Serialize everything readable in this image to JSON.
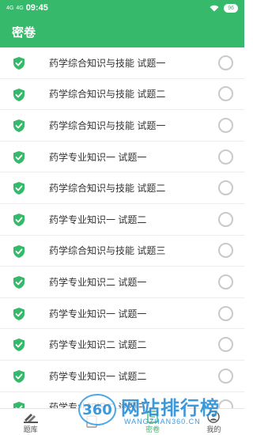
{
  "status_bar": {
    "signal1": "4G",
    "signal2": "4G",
    "time": "09:45",
    "battery": "96"
  },
  "app_bar": {
    "title": "密卷"
  },
  "papers": [
    {
      "title": "药学综合知识与技能 试题一",
      "selected": false
    },
    {
      "title": "药学综合知识与技能 试题二",
      "selected": false
    },
    {
      "title": "药学综合知识与技能 试题一",
      "selected": false
    },
    {
      "title": "药学专业知识一 试题一",
      "selected": false
    },
    {
      "title": "药学综合知识与技能 试题二",
      "selected": false
    },
    {
      "title": "药学专业知识一 试题二",
      "selected": false
    },
    {
      "title": "药学综合知识与技能 试题三",
      "selected": false
    },
    {
      "title": "药学专业知识二 试题一",
      "selected": false
    },
    {
      "title": "药学专业知识一 试题一",
      "selected": false
    },
    {
      "title": "药学专业知识二 试题二",
      "selected": false
    },
    {
      "title": "药学专业知识一 试题二",
      "selected": false
    },
    {
      "title": "药学专业知识二 试题三",
      "selected": false
    }
  ],
  "bottom_nav": {
    "items": [
      {
        "label": "题库",
        "icon": "books-icon"
      },
      {
        "label": "",
        "icon": "exam-icon"
      },
      {
        "label": "密卷",
        "icon": "secret-paper-icon"
      },
      {
        "label": "我的",
        "icon": "user-icon"
      }
    ]
  },
  "watermark": {
    "badge": "360",
    "title": "网站排行榜",
    "subtitle": "WANGZHAN360.CN"
  },
  "colors": {
    "primary": "#37b96b",
    "radio_border": "#c9c9c9",
    "watermark": "#2a8fd8"
  }
}
